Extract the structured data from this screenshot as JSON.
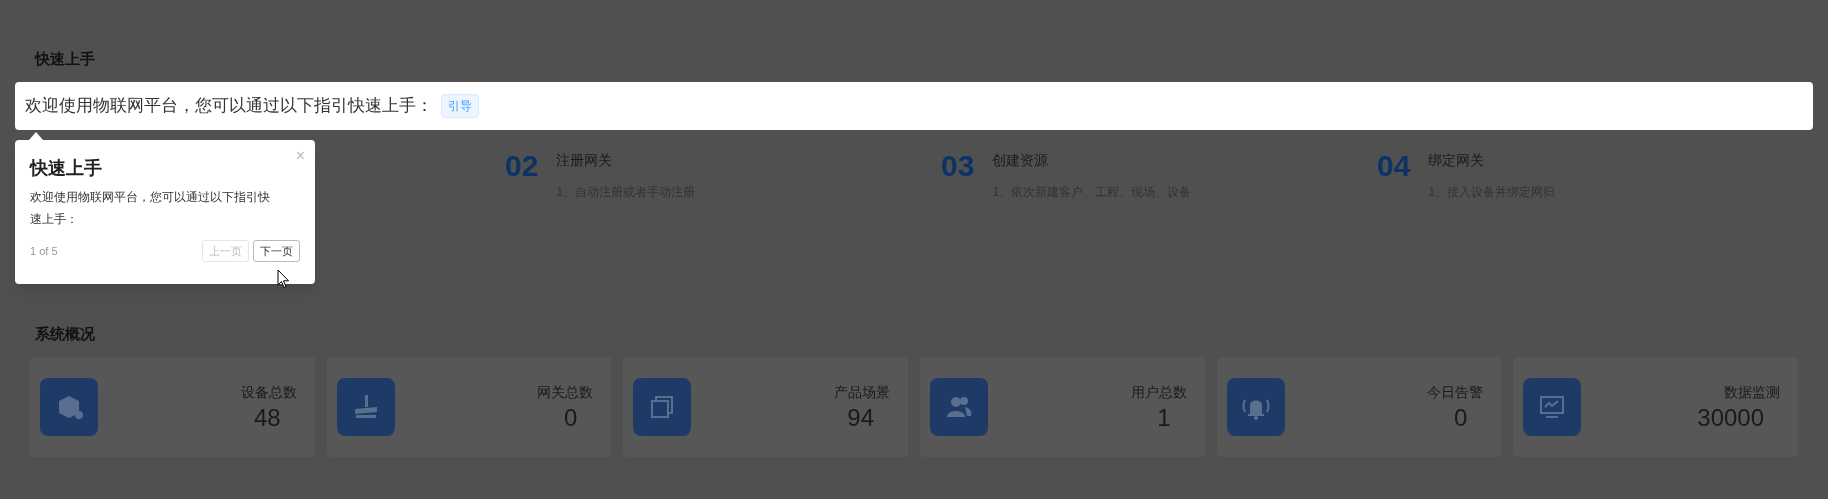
{
  "quick_start": {
    "title": "快速上手",
    "banner": {
      "text": "欢迎使用物联网平台，您可以通过以下指引快速上手：",
      "tag": "引导"
    },
    "steps": [
      {
        "number": "02",
        "title": "注册网关",
        "description": "1、自动注册或者手动注册"
      },
      {
        "number": "03",
        "title": "创建资源",
        "description": "1、依次新建客户、工程、现场、设备"
      },
      {
        "number": "04",
        "title": "绑定网关",
        "description": "1、接入设备并绑定网归"
      }
    ]
  },
  "tour_popover": {
    "close": "×",
    "title": "快速上手",
    "body": "欢迎使用物联网平台，您可以通过以下指引快速上手：",
    "progress": "1 of 5",
    "buttons": [
      {
        "label": "上一页",
        "disabled": true
      },
      {
        "label": "下一页",
        "disabled": false
      }
    ]
  },
  "overview": {
    "title": "系统概况",
    "cards": [
      {
        "kind": "box",
        "label": "设备总数",
        "value": "48"
      },
      {
        "kind": "gateway",
        "label": "网关总数",
        "value": "0"
      },
      {
        "kind": "layers",
        "label": "产品场景",
        "value": "94"
      },
      {
        "kind": "users",
        "label": "用户总数",
        "value": "1"
      },
      {
        "kind": "bell",
        "label": "今日告警",
        "value": "0"
      },
      {
        "kind": "monitor",
        "label": "数据监测",
        "value": "30000"
      }
    ]
  }
}
